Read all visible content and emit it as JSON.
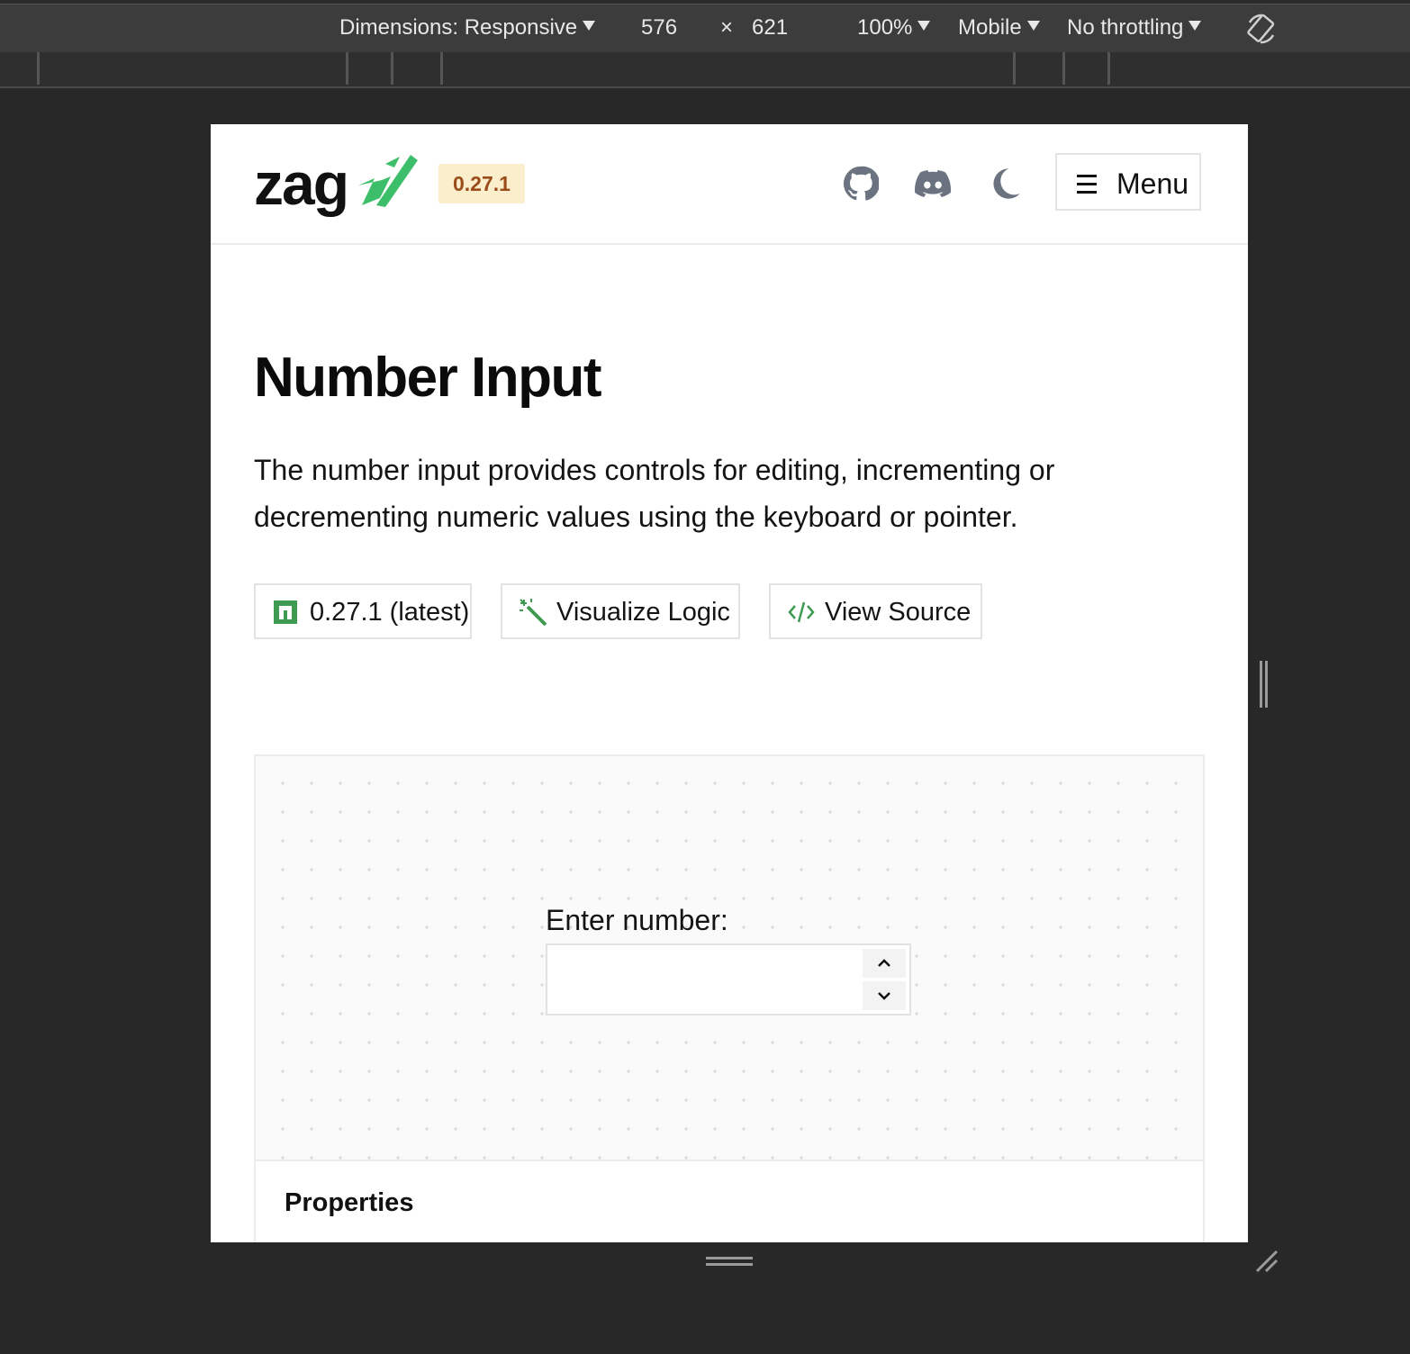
{
  "devtools": {
    "dimensions_label": "Dimensions: Responsive",
    "width": "576",
    "times": "×",
    "height": "621",
    "zoom": "100%",
    "device_type": "Mobile",
    "throttling": "No throttling",
    "icons": [
      "rotate-icon"
    ]
  },
  "header": {
    "logo": "zag",
    "version": "0.27.1",
    "icons": [
      "github-icon",
      "discord-icon",
      "moon-icon"
    ],
    "menu_label": "Menu"
  },
  "page": {
    "title": "Number Input",
    "description": "The number input provides controls for editing, incrementing or decrementing numeric values using the keyboard or pointer."
  },
  "links": {
    "npm_label": "0.27.1 (latest)",
    "visualize_label": "Visualize Logic",
    "source_label": "View Source"
  },
  "playground": {
    "field_label": "Enter number:",
    "input_value": ""
  },
  "properties": {
    "title": "Properties"
  },
  "colors": {
    "accent_green": "#3dbe6a",
    "badge_bg": "#fbeecd",
    "badge_text": "#9a4c1a",
    "devtools_bg": "#282828"
  }
}
